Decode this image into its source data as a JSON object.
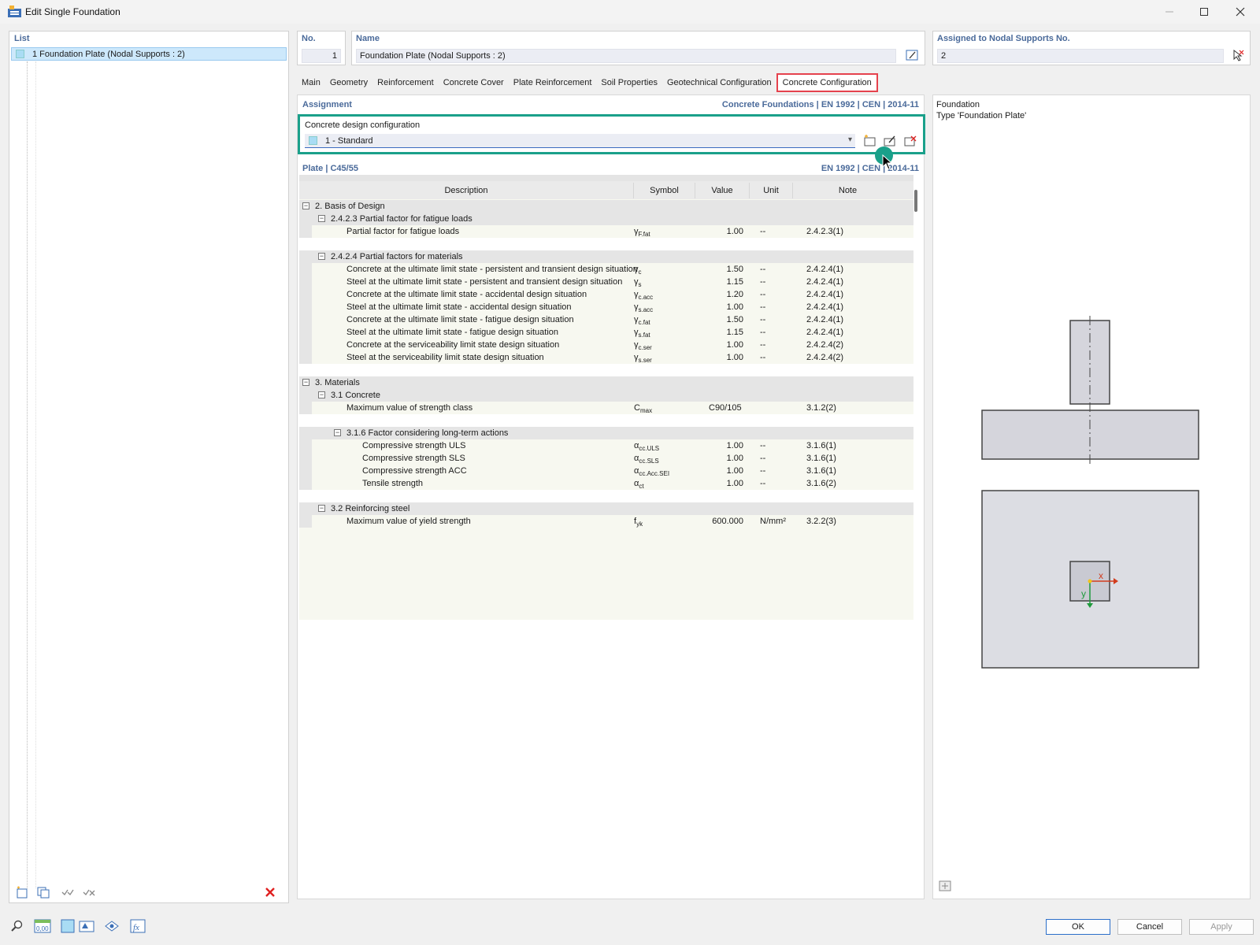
{
  "window": {
    "title": "Edit Single Foundation"
  },
  "list": {
    "title": "List",
    "items": [
      {
        "label": "1  Foundation Plate (Nodal Supports : 2)"
      }
    ]
  },
  "header": {
    "no_label": "No.",
    "no_value": "1",
    "name_label": "Name",
    "name_value": "Foundation Plate (Nodal Supports : 2)",
    "assigned_label": "Assigned to Nodal Supports No.",
    "assigned_value": "2"
  },
  "tabs": [
    {
      "label": "Main"
    },
    {
      "label": "Geometry"
    },
    {
      "label": "Reinforcement"
    },
    {
      "label": "Concrete Cover"
    },
    {
      "label": "Plate Reinforcement"
    },
    {
      "label": "Soil Properties"
    },
    {
      "label": "Geotechnical Configuration"
    },
    {
      "label": "Concrete Configuration",
      "active": true
    }
  ],
  "assignment": {
    "label": "Assignment",
    "code": "Concrete Foundations | EN 1992 | CEN | 2014-11",
    "config_label": "Concrete design configuration",
    "config_value": "1 - Standard"
  },
  "plate": {
    "label": "Plate | C45/55",
    "code": "EN 1992 | CEN | 2014-11"
  },
  "table": {
    "headers": {
      "description": "Description",
      "symbol": "Symbol",
      "value": "Value",
      "unit": "Unit",
      "note": "Note"
    },
    "rows": [
      {
        "type": "sec",
        "level": 0,
        "desc": "2. Basis of Design"
      },
      {
        "type": "sec",
        "level": 1,
        "desc": "2.4.2.3 Partial factor for fatigue loads"
      },
      {
        "type": "item",
        "level": 2,
        "desc": "Partial factor for fatigue loads",
        "sym": "γ",
        "sub": "F.fat",
        "val": "1.00",
        "unit": "--",
        "note": "2.4.2.3(1)"
      },
      {
        "type": "blank"
      },
      {
        "type": "sec",
        "level": 1,
        "desc": "2.4.2.4 Partial factors for materials"
      },
      {
        "type": "item",
        "level": 2,
        "desc": "Concrete at the ultimate limit state - persistent and transient design situation",
        "sym": "γ",
        "sub": "c",
        "val": "1.50",
        "unit": "--",
        "note": "2.4.2.4(1)"
      },
      {
        "type": "item",
        "level": 2,
        "desc": "Steel at the ultimate limit state - persistent and transient design situation",
        "sym": "γ",
        "sub": "s",
        "val": "1.15",
        "unit": "--",
        "note": "2.4.2.4(1)"
      },
      {
        "type": "item",
        "level": 2,
        "desc": "Concrete at the ultimate limit state - accidental design situation",
        "sym": "γ",
        "sub": "c.acc",
        "val": "1.20",
        "unit": "--",
        "note": "2.4.2.4(1)"
      },
      {
        "type": "item",
        "level": 2,
        "desc": "Steel at the ultimate limit state - accidental design situation",
        "sym": "γ",
        "sub": "s.acc",
        "val": "1.00",
        "unit": "--",
        "note": "2.4.2.4(1)"
      },
      {
        "type": "item",
        "level": 2,
        "desc": "Concrete at the ultimate limit state - fatigue design situation",
        "sym": "γ",
        "sub": "c.fat",
        "val": "1.50",
        "unit": "--",
        "note": "2.4.2.4(1)"
      },
      {
        "type": "item",
        "level": 2,
        "desc": "Steel at the ultimate limit state - fatigue design situation",
        "sym": "γ",
        "sub": "s.fat",
        "val": "1.15",
        "unit": "--",
        "note": "2.4.2.4(1)"
      },
      {
        "type": "item",
        "level": 2,
        "desc": "Concrete at the serviceability limit state design situation",
        "sym": "γ",
        "sub": "c.ser",
        "val": "1.00",
        "unit": "--",
        "note": "2.4.2.4(2)"
      },
      {
        "type": "item",
        "level": 2,
        "desc": "Steel at the serviceability limit state design situation",
        "sym": "γ",
        "sub": "s.ser",
        "val": "1.00",
        "unit": "--",
        "note": "2.4.2.4(2)"
      },
      {
        "type": "blank"
      },
      {
        "type": "sec",
        "level": 0,
        "desc": "3. Materials"
      },
      {
        "type": "sec",
        "level": 1,
        "desc": "3.1 Concrete"
      },
      {
        "type": "item",
        "level": 2,
        "desc": "Maximum value of strength class",
        "sym": "C",
        "sub": "max",
        "val": "C90/105",
        "valtxt": true,
        "unit": "",
        "note": "3.1.2(2)"
      },
      {
        "type": "blank"
      },
      {
        "type": "sec",
        "level": 2,
        "desc": "3.1.6 Factor considering long-term actions"
      },
      {
        "type": "item",
        "level": 3,
        "desc": "Compressive strength ULS",
        "sym": "α",
        "sub": "cc.ULS",
        "val": "1.00",
        "unit": "--",
        "note": "3.1.6(1)"
      },
      {
        "type": "item",
        "level": 3,
        "desc": "Compressive strength SLS",
        "sym": "α",
        "sub": "cc.SLS",
        "val": "1.00",
        "unit": "--",
        "note": "3.1.6(1)"
      },
      {
        "type": "item",
        "level": 3,
        "desc": "Compressive strength ACC",
        "sym": "α",
        "sub": "cc.Acc.SEI",
        "val": "1.00",
        "unit": "--",
        "note": "3.1.6(1)"
      },
      {
        "type": "item",
        "level": 3,
        "desc": "Tensile strength",
        "sym": "α",
        "sub": "ct",
        "val": "1.00",
        "unit": "--",
        "note": "3.1.6(2)"
      },
      {
        "type": "blank"
      },
      {
        "type": "sec",
        "level": 1,
        "desc": "3.2 Reinforcing steel"
      },
      {
        "type": "item",
        "level": 2,
        "desc": "Maximum value of yield strength",
        "sym": "f",
        "sub": "yk",
        "val": "600.000",
        "unit": "N/mm²",
        "note": "3.2.2(3)"
      }
    ]
  },
  "preview": {
    "title": "Foundation",
    "type": "Type 'Foundation Plate'",
    "axis_x": "x",
    "axis_y": "y"
  },
  "buttons": {
    "ok": "OK",
    "cancel": "Cancel",
    "apply": "Apply"
  },
  "colors": {
    "accent_tab": "#e5424d",
    "highlight_box": "#1aa08a"
  }
}
